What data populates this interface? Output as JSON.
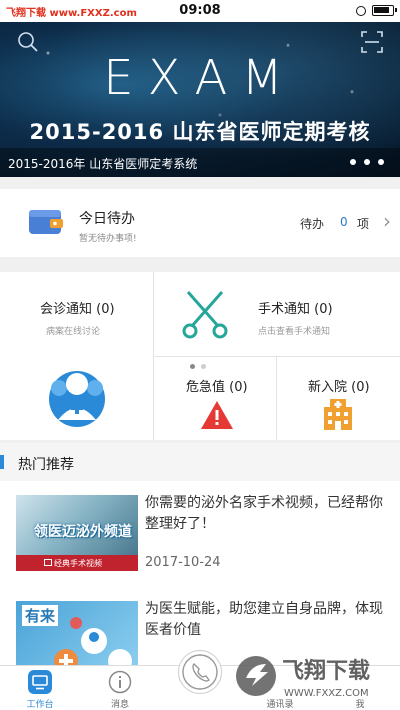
{
  "status_bar": {
    "carrier": "飞翔下载 www.FXXZ.com",
    "time": "09:08"
  },
  "banner": {
    "logo_text": "EXAM",
    "headline": "2015-2016 山东省医师定期考核",
    "caption": "2015-2016年 山东省医师定考系统",
    "page_count": 3
  },
  "todo": {
    "title": "今日待办",
    "subtitle": "暂无待办事项!",
    "status_label": "待办",
    "count": "0",
    "unit": "项"
  },
  "tiles": {
    "consult": {
      "title": "会诊通知 (0)",
      "subtitle": "病案在线讨论"
    },
    "surgery": {
      "title": "手术通知 (0)",
      "subtitle": "点击查看手术通知"
    },
    "critical": {
      "title": "危急值 (0)"
    },
    "admission": {
      "title": "新入院 (0)"
    }
  },
  "hot": {
    "title": "热门推荐",
    "articles": [
      {
        "title": "你需要的泌外名家手术视频，已经帮你整理好了！",
        "date": "2017-10-24",
        "thumb_text": "领医迈泌外频道",
        "thumb_strip": "经典手术视频"
      },
      {
        "title": "为医生赋能，助您建立自身品牌，体现医者价值",
        "thumb_text": "有来"
      }
    ]
  },
  "tabs": [
    {
      "label": "工作台",
      "icon": "desktop-icon"
    },
    {
      "label": "消息",
      "icon": "info-icon"
    },
    {
      "label": "通讯录",
      "icon": "contacts-icon"
    },
    {
      "label": "我",
      "icon": "person-icon"
    }
  ],
  "watermark": {
    "brand": "飞翔下载",
    "url": "WWW.FXXZ.COM"
  },
  "colors": {
    "accent": "#2a8ad8",
    "teal": "#26a69a",
    "red": "#e53935",
    "orange": "#f0a030"
  }
}
